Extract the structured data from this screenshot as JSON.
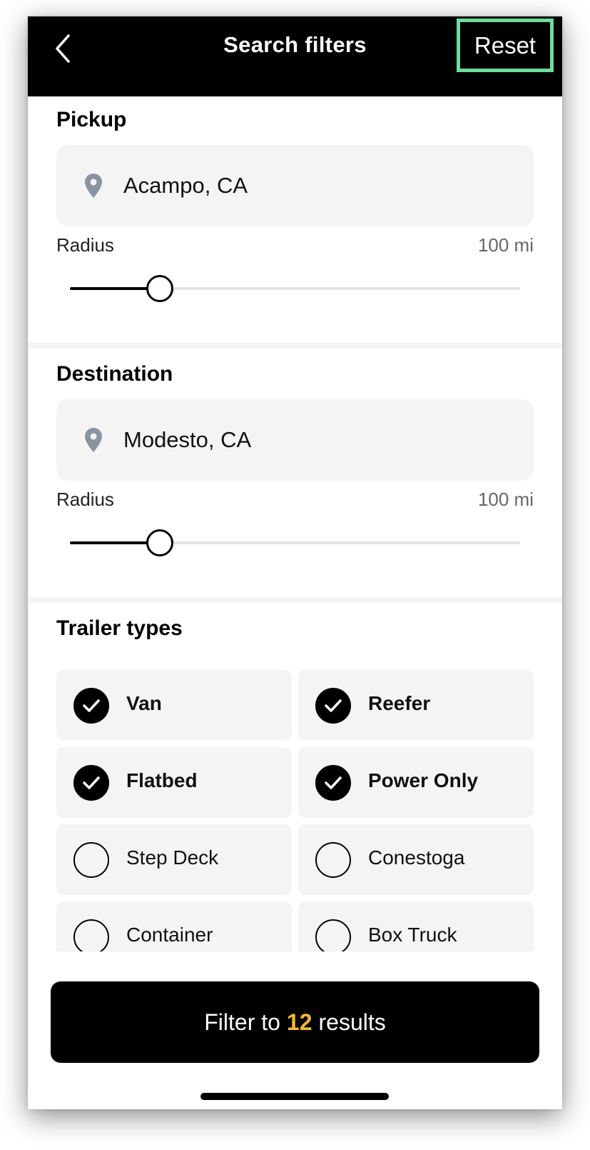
{
  "header": {
    "title": "Search filters",
    "reset_label": "Reset",
    "back_icon": "chevron-left-icon"
  },
  "pickup": {
    "title": "Pickup",
    "location": "Acampo, CA",
    "radius_label": "Radius",
    "radius_value": "100 mi",
    "slider_fraction": 0.2
  },
  "destination": {
    "title": "Destination",
    "location": "Modesto, CA",
    "radius_label": "Radius",
    "radius_value": "100 mi",
    "slider_fraction": 0.2
  },
  "trailer_types": {
    "title": "Trailer types",
    "items": [
      {
        "label": "Van",
        "checked": true
      },
      {
        "label": "Reefer",
        "checked": true
      },
      {
        "label": "Flatbed",
        "checked": true
      },
      {
        "label": "Power Only",
        "checked": true
      },
      {
        "label": "Step Deck",
        "checked": false
      },
      {
        "label": "Conestoga",
        "checked": false
      },
      {
        "label": "Container",
        "checked": false
      },
      {
        "label": "Box Truck",
        "checked": false
      }
    ]
  },
  "filter_button": {
    "prefix": "Filter to",
    "count": "12",
    "suffix": "results"
  },
  "colors": {
    "accent": "#f5b731",
    "highlight_border": "#6fdc9b",
    "pin": "#8a94a1"
  }
}
